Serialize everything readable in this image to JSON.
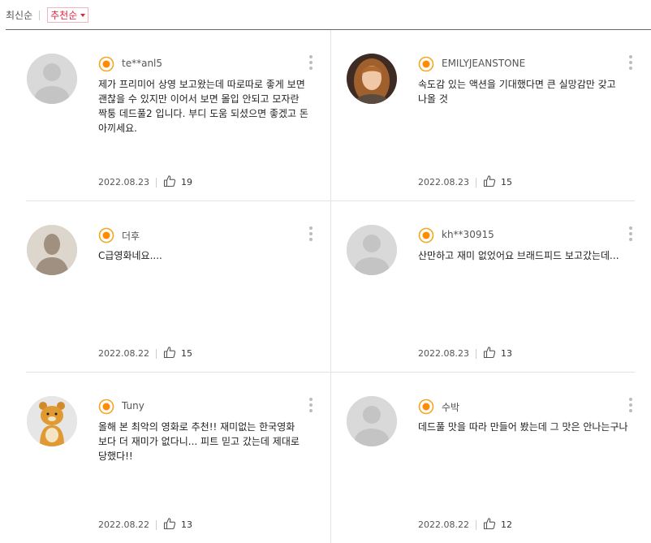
{
  "sort": {
    "latest": "최신순",
    "recommended": "추천순"
  },
  "reviews": [
    {
      "user": "te**anl5",
      "avatar": "default-avatar",
      "text": "제가 프리미어 상영 보고왔는데 따로따로 좋게 보면 괜찮을 수 있지만 이어서 보면 몰입 안되고 모자란 짝퉁 데드풀2 입니다. 부디 도움 되셨으면 좋겠고 돈 아끼세요.",
      "date": "2022.08.23",
      "likes": "19"
    },
    {
      "user": "EMILYJEANSTONE",
      "avatar": "photo-avatar",
      "text": "속도감 있는 액션을 기대했다면 큰 실망감만 갖고 나올 것",
      "date": "2022.08.23",
      "likes": "15"
    },
    {
      "user": "더후",
      "avatar": "silhouette-avatar",
      "text": "C급영화네요....",
      "date": "2022.08.22",
      "likes": "15"
    },
    {
      "user": "kh**30915",
      "avatar": "default-avatar",
      "text": "산만하고 재미 없었어요 브래드피드 보고갔는데...",
      "date": "2022.08.23",
      "likes": "13"
    },
    {
      "user": "Tuny",
      "avatar": "character-avatar",
      "text": "올해 본 최악의 영화로 추천!! 재미없는 한국영화 보다 더 재미가 없다니... 피트 믿고 갔는데 제대로 당했다!!",
      "date": "2022.08.22",
      "likes": "13"
    },
    {
      "user": "수박",
      "avatar": "default-avatar",
      "text": "데드풀 맛을 따라 만들어 봤는데 그 맛은 안나는구나",
      "date": "2022.08.22",
      "likes": "12"
    }
  ],
  "colors": {
    "accent": "#e0233d",
    "badge_yellow": "#f5a623",
    "badge_orange": "#ff8c00"
  }
}
